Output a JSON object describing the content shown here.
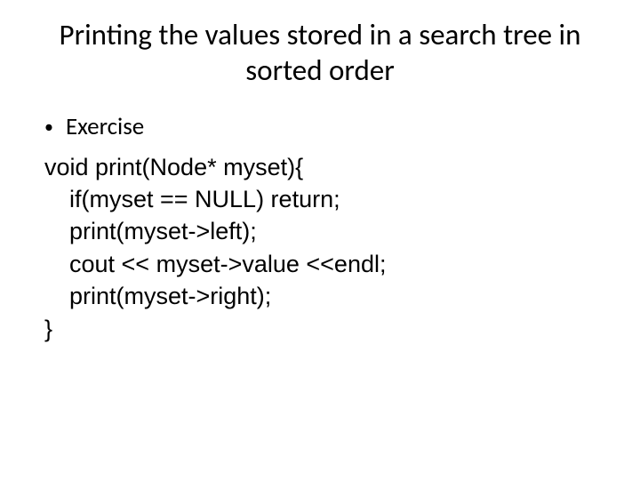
{
  "title": "Printing the values stored in a search tree in sorted order",
  "bullet": {
    "marker": "•",
    "text": "Exercise"
  },
  "code": {
    "line1": "void print(Node* myset){",
    "line2": "if(myset == NULL) return;",
    "line3": "print(myset->left);",
    "line4": "cout << myset->value <<endl;",
    "line5": "print(myset->right);",
    "line6": "}"
  }
}
